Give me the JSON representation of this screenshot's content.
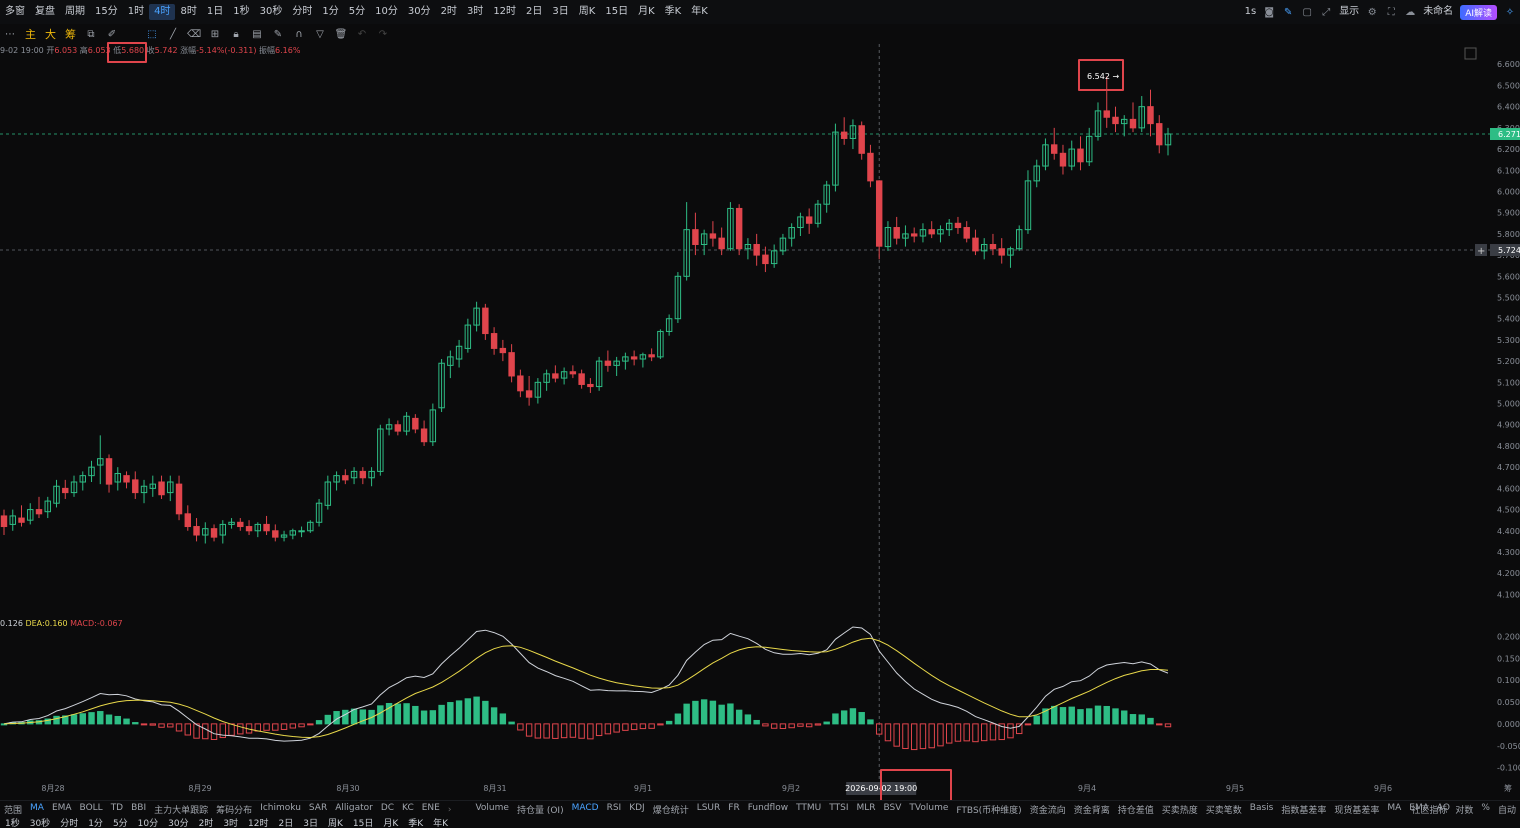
{
  "topbar": {
    "left_items": [
      "多窗",
      "复盘",
      "周期",
      "15分",
      "1时",
      "4时",
      "8时",
      "1日",
      "1秒",
      "30秒",
      "分时",
      "1分",
      "5分",
      "10分",
      "30分",
      "2时",
      "3时",
      "12时",
      "2日",
      "3日",
      "周K",
      "15日",
      "月K",
      "季K",
      "年K"
    ],
    "active_index": 5,
    "right": {
      "interval": "1s",
      "display": "显示",
      "unnamed": "未命名",
      "ai": "AI解读"
    }
  },
  "drawtoolbar": {
    "main": "主",
    "big": "大",
    "chip": "筹"
  },
  "ohlc": {
    "time": "9-02 19:00",
    "open_label": "开",
    "open": "6.053",
    "high_label": "高",
    "high": "6.053",
    "low_label": "低",
    "low": "5.680",
    "close_label": "收",
    "close": "5.742",
    "change_label": "涨幅",
    "change": "-5.14%(-0.311)",
    "amp_label": "振幅",
    "amp": "6.16%"
  },
  "price_axis": {
    "ticks": [
      "6.600",
      "6.500",
      "6.400",
      "6.300",
      "6.200",
      "6.100",
      "6.000",
      "5.900",
      "5.800",
      "5.700",
      "5.600",
      "5.500",
      "5.400",
      "5.300",
      "5.200",
      "5.100",
      "5.000",
      "4.900",
      "4.800",
      "4.700",
      "4.600",
      "4.500",
      "4.400",
      "4.300",
      "4.200",
      "4.100"
    ],
    "last_price": "6.271",
    "crosshair_price": "5.724",
    "max_label": "6.542"
  },
  "macd": {
    "dif_label": "0.126",
    "dea_label": "DEA:0.160",
    "macd_label": "MACD:-0.067",
    "ticks": [
      "0.200",
      "0.150",
      "0.100",
      "0.050",
      "0.000",
      "-0.050",
      "-0.100"
    ]
  },
  "time_axis": {
    "labels": [
      "8月28",
      "8月29",
      "8月30",
      "8月31",
      "9月1",
      "9月2",
      "9月4",
      "9月5",
      "9月6"
    ],
    "crosshair": "2026-09-02 19:00",
    "right_mark": "筹"
  },
  "indicator_bar": {
    "main_items": [
      "范围",
      "MA",
      "EMA",
      "BOLL",
      "TD",
      "BBI",
      "主力大单跟踪",
      "筹码分布",
      "Ichimoku",
      "SAR",
      "Alligator",
      "DC",
      "KC",
      "ENE"
    ],
    "main_active": "MA",
    "sub_items": [
      "Volume",
      "持仓量 (OI)",
      "MACD",
      "RSI",
      "KDJ",
      "爆仓统计",
      "LSUR",
      "FR",
      "Fundflow",
      "TTMU",
      "TTSI",
      "MLR",
      "BSV",
      "TVolume",
      "FTBS(币种维度)",
      "资金流向",
      "资金背离",
      "持仓差值",
      "买卖热度",
      "买卖笔数",
      "Basis",
      "指数基差率",
      "现货基差率",
      "MA",
      "EMA",
      "AO"
    ],
    "sub_active": "MACD",
    "right_items": [
      "社区指标",
      "对数",
      "%",
      "自动"
    ]
  },
  "bottom_bar": {
    "items": [
      "1秒",
      "30秒",
      "分时",
      "1分",
      "5分",
      "10分",
      "30分",
      "2时",
      "3时",
      "12时",
      "2日",
      "3日",
      "周K",
      "15日",
      "月K",
      "季K",
      "年K"
    ]
  },
  "colors": {
    "up": "#2ebd85",
    "down": "#e0454c",
    "dif": "#cfd3da",
    "dea": "#e8d84a",
    "accent": "#4aa3ff"
  },
  "chart_data": {
    "type": "candlestick",
    "title": "",
    "xlabel": "",
    "ylabel": "",
    "ylim": [
      4.05,
      6.62
    ],
    "ohlc": [
      [
        4.47,
        4.5,
        4.38,
        4.42
      ],
      [
        4.43,
        4.5,
        4.4,
        4.47
      ],
      [
        4.46,
        4.52,
        4.42,
        4.44
      ],
      [
        4.45,
        4.53,
        4.43,
        4.5
      ],
      [
        4.5,
        4.56,
        4.46,
        4.48
      ],
      [
        4.49,
        4.56,
        4.46,
        4.54
      ],
      [
        4.53,
        4.64,
        4.51,
        4.61
      ],
      [
        4.6,
        4.64,
        4.55,
        4.58
      ],
      [
        4.58,
        4.66,
        4.56,
        4.63
      ],
      [
        4.63,
        4.68,
        4.59,
        4.66
      ],
      [
        4.66,
        4.73,
        4.63,
        4.7
      ],
      [
        4.71,
        4.85,
        4.62,
        4.74
      ],
      [
        4.74,
        4.76,
        4.58,
        4.62
      ],
      [
        4.63,
        4.7,
        4.59,
        4.67
      ],
      [
        4.66,
        4.68,
        4.6,
        4.63
      ],
      [
        4.64,
        4.68,
        4.55,
        4.58
      ],
      [
        4.58,
        4.64,
        4.53,
        4.61
      ],
      [
        4.6,
        4.66,
        4.56,
        4.62
      ],
      [
        4.63,
        4.66,
        4.55,
        4.57
      ],
      [
        4.58,
        4.66,
        4.54,
        4.63
      ],
      [
        4.62,
        4.66,
        4.45,
        4.48
      ],
      [
        4.48,
        4.52,
        4.4,
        4.42
      ],
      [
        4.42,
        4.46,
        4.35,
        4.38
      ],
      [
        4.38,
        4.44,
        4.34,
        4.41
      ],
      [
        4.41,
        4.43,
        4.35,
        4.37
      ],
      [
        4.38,
        4.45,
        4.34,
        4.43
      ],
      [
        4.43,
        4.46,
        4.41,
        4.44
      ],
      [
        4.44,
        4.46,
        4.4,
        4.42
      ],
      [
        4.42,
        4.45,
        4.38,
        4.4
      ],
      [
        4.4,
        4.44,
        4.37,
        4.43
      ],
      [
        4.43,
        4.47,
        4.38,
        4.4
      ],
      [
        4.4,
        4.43,
        4.35,
        4.37
      ],
      [
        4.37,
        4.4,
        4.35,
        4.38
      ],
      [
        4.38,
        4.41,
        4.36,
        4.4
      ],
      [
        4.4,
        4.42,
        4.37,
        4.4
      ],
      [
        4.4,
        4.45,
        4.39,
        4.44
      ],
      [
        4.44,
        4.55,
        4.42,
        4.53
      ],
      [
        4.52,
        4.66,
        4.5,
        4.63
      ],
      [
        4.63,
        4.68,
        4.59,
        4.66
      ],
      [
        4.66,
        4.69,
        4.62,
        4.64
      ],
      [
        4.65,
        4.7,
        4.62,
        4.68
      ],
      [
        4.68,
        4.7,
        4.62,
        4.65
      ],
      [
        4.65,
        4.7,
        4.61,
        4.68
      ],
      [
        4.68,
        4.9,
        4.66,
        4.88
      ],
      [
        4.88,
        4.93,
        4.85,
        4.9
      ],
      [
        4.9,
        4.92,
        4.85,
        4.87
      ],
      [
        4.87,
        4.96,
        4.85,
        4.94
      ],
      [
        4.93,
        4.95,
        4.86,
        4.88
      ],
      [
        4.88,
        4.92,
        4.8,
        4.82
      ],
      [
        4.82,
        5.0,
        4.8,
        4.97
      ],
      [
        4.98,
        5.21,
        4.96,
        5.19
      ],
      [
        5.18,
        5.25,
        5.12,
        5.22
      ],
      [
        5.21,
        5.3,
        5.17,
        5.27
      ],
      [
        5.26,
        5.4,
        5.24,
        5.37
      ],
      [
        5.37,
        5.48,
        5.34,
        5.45
      ],
      [
        5.45,
        5.47,
        5.3,
        5.33
      ],
      [
        5.33,
        5.36,
        5.23,
        5.26
      ],
      [
        5.26,
        5.3,
        5.2,
        5.24
      ],
      [
        5.24,
        5.28,
        5.1,
        5.13
      ],
      [
        5.13,
        5.16,
        5.03,
        5.06
      ],
      [
        5.06,
        5.13,
        4.99,
        5.03
      ],
      [
        5.03,
        5.12,
        5.0,
        5.1
      ],
      [
        5.1,
        5.16,
        5.06,
        5.14
      ],
      [
        5.14,
        5.18,
        5.1,
        5.12
      ],
      [
        5.12,
        5.17,
        5.09,
        5.15
      ],
      [
        5.15,
        5.18,
        5.12,
        5.14
      ],
      [
        5.14,
        5.16,
        5.07,
        5.09
      ],
      [
        5.09,
        5.12,
        5.05,
        5.08
      ],
      [
        5.08,
        5.22,
        5.06,
        5.2
      ],
      [
        5.2,
        5.25,
        5.15,
        5.18
      ],
      [
        5.18,
        5.22,
        5.13,
        5.2
      ],
      [
        5.2,
        5.24,
        5.16,
        5.22
      ],
      [
        5.22,
        5.25,
        5.18,
        5.21
      ],
      [
        5.21,
        5.24,
        5.17,
        5.23
      ],
      [
        5.23,
        5.26,
        5.2,
        5.22
      ],
      [
        5.22,
        5.35,
        5.21,
        5.34
      ],
      [
        5.34,
        5.42,
        5.32,
        5.4
      ],
      [
        5.4,
        5.62,
        5.38,
        5.6
      ],
      [
        5.6,
        5.95,
        5.58,
        5.82
      ],
      [
        5.82,
        5.9,
        5.7,
        5.75
      ],
      [
        5.75,
        5.82,
        5.7,
        5.8
      ],
      [
        5.8,
        5.86,
        5.74,
        5.78
      ],
      [
        5.78,
        5.83,
        5.7,
        5.73
      ],
      [
        5.73,
        5.95,
        5.72,
        5.92
      ],
      [
        5.92,
        5.94,
        5.7,
        5.73
      ],
      [
        5.73,
        5.78,
        5.68,
        5.75
      ],
      [
        5.75,
        5.8,
        5.65,
        5.7
      ],
      [
        5.7,
        5.74,
        5.62,
        5.66
      ],
      [
        5.66,
        5.75,
        5.64,
        5.72
      ],
      [
        5.72,
        5.8,
        5.7,
        5.78
      ],
      [
        5.78,
        5.85,
        5.74,
        5.83
      ],
      [
        5.83,
        5.9,
        5.79,
        5.88
      ],
      [
        5.88,
        5.92,
        5.8,
        5.85
      ],
      [
        5.85,
        5.96,
        5.83,
        5.94
      ],
      [
        5.94,
        6.05,
        5.9,
        6.03
      ],
      [
        6.03,
        6.32,
        6.0,
        6.28
      ],
      [
        6.28,
        6.35,
        6.22,
        6.25
      ],
      [
        6.25,
        6.34,
        6.2,
        6.31
      ],
      [
        6.31,
        6.33,
        6.15,
        6.18
      ],
      [
        6.18,
        6.22,
        6.02,
        6.05
      ],
      [
        6.05,
        6.053,
        5.68,
        5.742
      ],
      [
        5.74,
        5.86,
        5.72,
        5.83
      ],
      [
        5.83,
        5.88,
        5.75,
        5.78
      ],
      [
        5.78,
        5.84,
        5.74,
        5.8
      ],
      [
        5.8,
        5.83,
        5.76,
        5.79
      ],
      [
        5.79,
        5.85,
        5.76,
        5.82
      ],
      [
        5.82,
        5.86,
        5.78,
        5.8
      ],
      [
        5.8,
        5.84,
        5.76,
        5.82
      ],
      [
        5.82,
        5.87,
        5.79,
        5.85
      ],
      [
        5.85,
        5.88,
        5.8,
        5.83
      ],
      [
        5.83,
        5.86,
        5.76,
        5.78
      ],
      [
        5.78,
        5.82,
        5.7,
        5.72
      ],
      [
        5.72,
        5.78,
        5.68,
        5.75
      ],
      [
        5.75,
        5.8,
        5.7,
        5.73
      ],
      [
        5.73,
        5.78,
        5.66,
        5.7
      ],
      [
        5.7,
        5.74,
        5.64,
        5.73
      ],
      [
        5.73,
        5.84,
        5.72,
        5.82
      ],
      [
        5.82,
        6.1,
        5.8,
        6.05
      ],
      [
        6.05,
        6.15,
        6.02,
        6.12
      ],
      [
        6.12,
        6.25,
        6.1,
        6.22
      ],
      [
        6.22,
        6.3,
        6.15,
        6.18
      ],
      [
        6.18,
        6.22,
        6.08,
        6.12
      ],
      [
        6.12,
        6.24,
        6.1,
        6.2
      ],
      [
        6.2,
        6.26,
        6.1,
        6.14
      ],
      [
        6.14,
        6.3,
        6.12,
        6.26
      ],
      [
        6.26,
        6.42,
        6.24,
        6.38
      ],
      [
        6.38,
        6.542,
        6.3,
        6.35
      ],
      [
        6.35,
        6.4,
        6.28,
        6.32
      ],
      [
        6.32,
        6.36,
        6.26,
        6.34
      ],
      [
        6.34,
        6.42,
        6.28,
        6.3
      ],
      [
        6.3,
        6.45,
        6.28,
        6.4
      ],
      [
        6.4,
        6.48,
        6.26,
        6.32
      ],
      [
        6.32,
        6.36,
        6.18,
        6.22
      ],
      [
        6.22,
        6.3,
        6.17,
        6.271
      ]
    ],
    "macd": {
      "ylim": [
        -0.11,
        0.21
      ]
    }
  }
}
